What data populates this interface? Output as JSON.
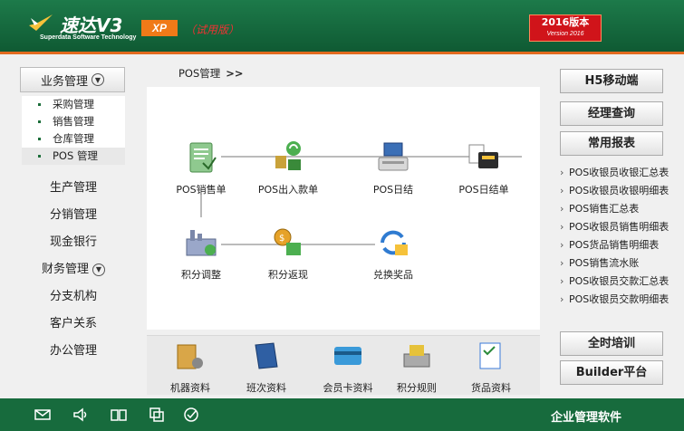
{
  "header": {
    "brand_name": "速达V3",
    "brand_sub": "Superdata Software Technology",
    "edition_badge": "XP",
    "trial_label": "（试用版）",
    "version_line1": "2016版本",
    "version_line2": "Version 2016"
  },
  "sidebar": {
    "business_group": "业务管理",
    "business_items": [
      "采购管理",
      "销售管理",
      "仓库管理",
      "POS 管理"
    ],
    "links": [
      "生产管理",
      "分销管理",
      "现金银行",
      "财务管理",
      "分支机构",
      "客户关系",
      "办公管理"
    ]
  },
  "breadcrumb": {
    "title": "POS管理",
    "arrow": ">>"
  },
  "flow": {
    "nodes": [
      "POS销售单",
      "POS出入款单",
      "POS日结",
      "POS日结单",
      "积分调整",
      "积分返现",
      "兑换奖品"
    ]
  },
  "tools": [
    "机器资料",
    "班次资料",
    "会员卡资料",
    "积分规则",
    "货品资料"
  ],
  "right": {
    "h5_button": "H5移动端",
    "manager_button": "经理查询",
    "reports_button": "常用报表",
    "reports": [
      "POS收银员收银汇总表",
      "POS收银员收银明细表",
      "POS销售汇总表",
      "POS收银员销售明细表",
      "POS货品销售明细表",
      "POS销售流水账",
      "POS收银员交款汇总表",
      "POS收银员交款明细表"
    ],
    "training_button": "全时培训",
    "builder_button": "Builder平台"
  },
  "footer": {
    "label": "企业管理软件"
  },
  "icons": [
    "mail-icon",
    "volume-icon",
    "book-icon",
    "windows-icon",
    "check-icon"
  ],
  "colors": {
    "header_green": "#1d7a4a",
    "accent_orange": "#e26a1f",
    "version_red": "#d0141a",
    "footer_green": "#176b3d"
  }
}
